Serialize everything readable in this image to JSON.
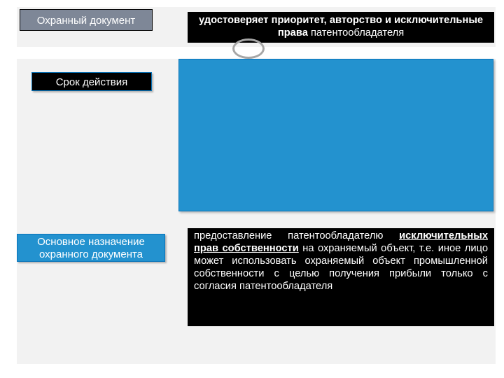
{
  "row1": {
    "label": "Охранный документ",
    "desc_bold": "удостоверяет приоритет, авторство и исключительные права",
    "desc_tail": " патентообладателя"
  },
  "row2": {
    "label": "Срок действия"
  },
  "row3": {
    "label_line1": "Основное назначение",
    "label_line2": "охранного документа",
    "desc_lead": "предоставление патентообладателю ",
    "desc_under": "исключительных прав собственности",
    "desc_tail": " на охраняемый объект, т.е. иное лицо может использовать охраняемый объект промышленной собственности с целью получения прибыли только с согласия патентообладателя"
  }
}
